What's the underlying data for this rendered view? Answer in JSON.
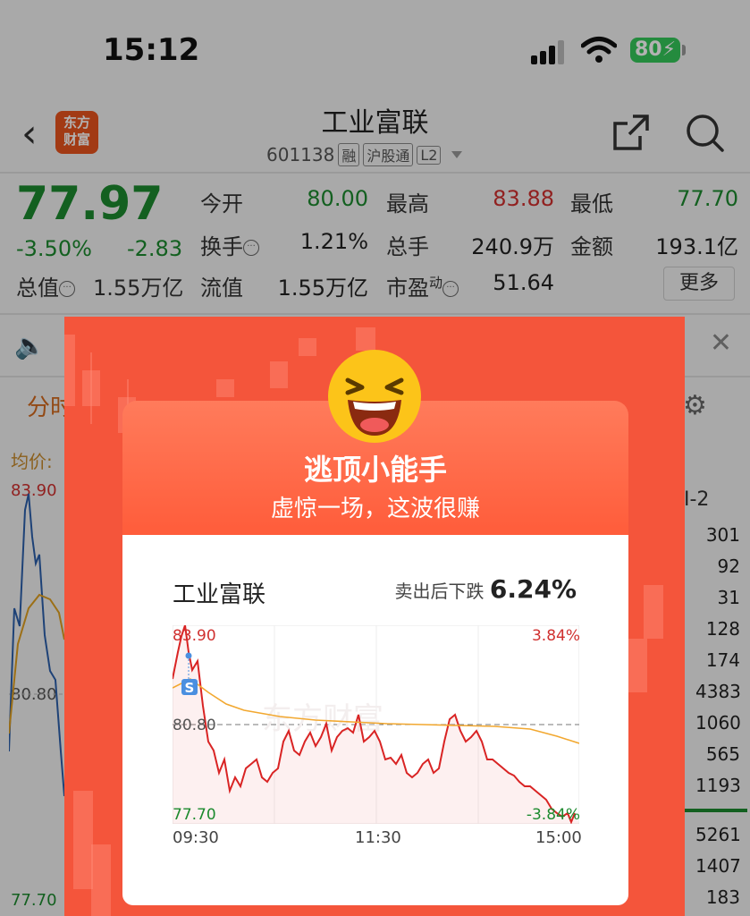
{
  "status": {
    "time": "15:12",
    "battery": "80"
  },
  "nav": {
    "back": "‹",
    "logo_line1": "东方",
    "logo_line2": "财富",
    "title": "工业富联",
    "code": "601138",
    "tag1": "融",
    "tag2": "沪股通",
    "tag3": "L2"
  },
  "quote": {
    "price": "77.97",
    "change_pct": "-3.50%",
    "change": "-2.83",
    "total_cap_label": "总值",
    "total_cap": "1.55万亿",
    "open_label": "今开",
    "open": "80.00",
    "high_label": "最高",
    "high": "83.88",
    "low_label": "最低",
    "low": "77.70",
    "turnover_label": "换手",
    "turnover": "1.21%",
    "volume_label": "总手",
    "volume": "240.9万",
    "amount_label": "金额",
    "amount": "193.1亿",
    "float_cap_label": "流值",
    "float_cap": "1.55万亿",
    "pe_label": "市盈",
    "pe_sup": "动",
    "pe": "51.64",
    "more": "更多"
  },
  "background": {
    "tab": "分时",
    "avg_label": "均价:",
    "hi": "83.90",
    "mid": "80.80",
    "lo": "77.70",
    "l2_label": "I-2",
    "right_numbers": [
      "301",
      "92",
      "31",
      "128",
      "174",
      "4383",
      "1060",
      "565",
      "1193",
      "5261",
      "1407",
      "183"
    ]
  },
  "popup": {
    "title": "逃顶小能手",
    "subtitle": "虚惊一场，这波很赚",
    "stock_name": "工业富联",
    "drop_label": "卖出后下跌",
    "drop_value": "6.24%",
    "chart": {
      "hi": "83.90",
      "mid": "80.80",
      "lo": "77.70",
      "hi_pct": "3.84%",
      "lo_pct": "-3.84%",
      "watermark": "东方财富",
      "times": [
        "09:30",
        "11:30",
        "15:00"
      ],
      "sell_marker": "S"
    }
  },
  "colors": {
    "up": "#d0302f",
    "down": "#1c8a2e",
    "popup_bg": "#f4553b",
    "accent": "#d36a1f"
  }
}
